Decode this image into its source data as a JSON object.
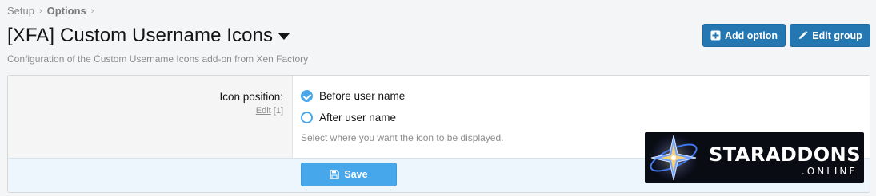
{
  "breadcrumb": [
    {
      "label": "Setup"
    },
    {
      "label": "Options"
    }
  ],
  "page": {
    "title": "[XFA] Custom Username Icons",
    "description": "Configuration of the Custom Username Icons add-on from Xen Factory"
  },
  "header_buttons": {
    "add_option": "Add option",
    "edit_group": "Edit group"
  },
  "option": {
    "label": "Icon position:",
    "edit_link": "Edit",
    "display_order": "[1]",
    "choices": [
      {
        "label": "Before user name",
        "selected": true
      },
      {
        "label": "After user name",
        "selected": false
      }
    ],
    "hint": "Select where you want the icon to be displayed."
  },
  "footer": {
    "save_label": "Save"
  },
  "watermark": {
    "line1": "STARADDONS",
    "line2": ".ONLINE"
  },
  "colors": {
    "primary_button": "#2577b1",
    "accent": "#47a7eb",
    "footer_bg": "#edf6fd"
  }
}
